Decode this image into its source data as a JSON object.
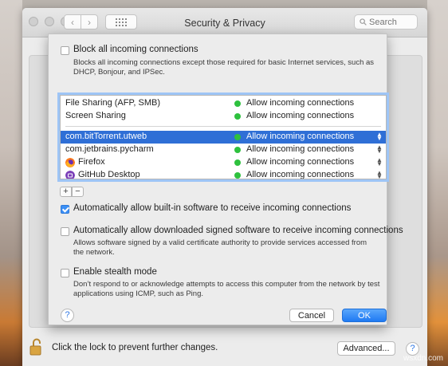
{
  "window": {
    "title": "Security & Privacy",
    "search_placeholder": "Search",
    "nav_back": "‹",
    "nav_forward": "›"
  },
  "firewall_options": {
    "block_all": {
      "label": "Block all incoming connections",
      "checked": false,
      "description": "Blocks all incoming connections except those required for basic Internet services, such as DHCP, Bonjour, and IPSec."
    },
    "apps": [
      {
        "name": "File Sharing (AFP, SMB)",
        "status": "Allow incoming connections",
        "icon": null,
        "stepper": false,
        "selected": false
      },
      {
        "name": "Screen Sharing",
        "status": "Allow incoming connections",
        "icon": null,
        "stepper": false,
        "selected": false
      },
      {
        "name": "com.bitTorrent.utweb",
        "status": "Allow incoming connections",
        "icon": null,
        "stepper": true,
        "selected": true
      },
      {
        "name": "com.jetbrains.pycharm",
        "status": "Allow incoming connections",
        "icon": null,
        "stepper": true,
        "selected": false
      },
      {
        "name": "Firefox",
        "status": "Allow incoming connections",
        "icon": "firefox-icon",
        "stepper": true,
        "selected": false
      },
      {
        "name": "GitHub Desktop",
        "status": "Allow incoming connections",
        "icon": "github-desktop-icon",
        "stepper": true,
        "selected": false
      }
    ],
    "add_label": "+",
    "remove_label": "−",
    "auto_builtin": {
      "label": "Automatically allow built-in software to receive incoming connections",
      "checked": true
    },
    "auto_signed": {
      "label": "Automatically allow downloaded signed software to receive incoming connections",
      "checked": false,
      "description": "Allows software signed by a valid certificate authority to provide services accessed from the network."
    },
    "stealth": {
      "label": "Enable stealth mode",
      "checked": false,
      "description": "Don’t respond to or acknowledge attempts to access this computer from the network by test applications using ICMP, such as Ping."
    },
    "help_label": "?",
    "cancel_label": "Cancel",
    "ok_label": "OK"
  },
  "footer": {
    "lock_text": "Click the lock to prevent further changes.",
    "advanced_label": "Advanced...",
    "help_label": "?"
  },
  "colors": {
    "accent": "#2f6fd6",
    "status_green": "#2ec13e",
    "default_button": "#1f7af3"
  },
  "watermark": "wsxdn.com"
}
